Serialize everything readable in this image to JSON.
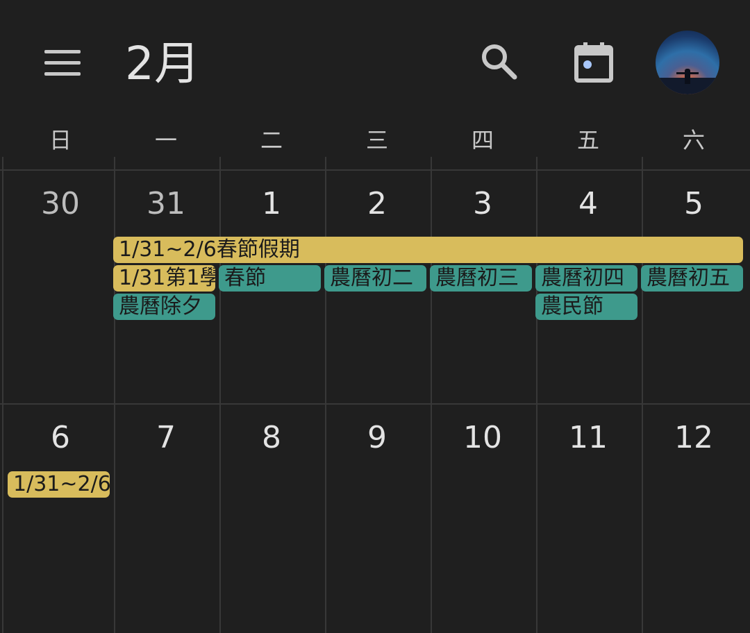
{
  "header": {
    "month_title": "2月"
  },
  "weekdays": [
    "日",
    "一",
    "二",
    "三",
    "四",
    "五",
    "六"
  ],
  "weeks": [
    {
      "days": [
        "30",
        "31",
        "1",
        "2",
        "3",
        "4",
        "5"
      ]
    },
    {
      "days": [
        "6",
        "7",
        "8",
        "9",
        "10",
        "11",
        "12"
      ]
    }
  ],
  "events": {
    "holiday_span": "1/31~2/6春節假期",
    "school_event": "1/31第1學",
    "spring_festival": "春節",
    "lunar_day2": "農曆初二",
    "lunar_day3": "農曆初三",
    "lunar_day4": "農曆初四",
    "lunar_day5": "農曆初五",
    "new_year_eve": "農曆除夕",
    "farmers_day": "農民節",
    "holiday_span_cont": "1/31~2/6"
  },
  "colors": {
    "background": "#1f1f1f",
    "holiday_yellow": "#d8bc5c",
    "festival_teal": "#3e9a8c",
    "grid": "#383838"
  },
  "icons": [
    "menu-icon",
    "search-icon",
    "calendar-today-icon",
    "avatar"
  ]
}
